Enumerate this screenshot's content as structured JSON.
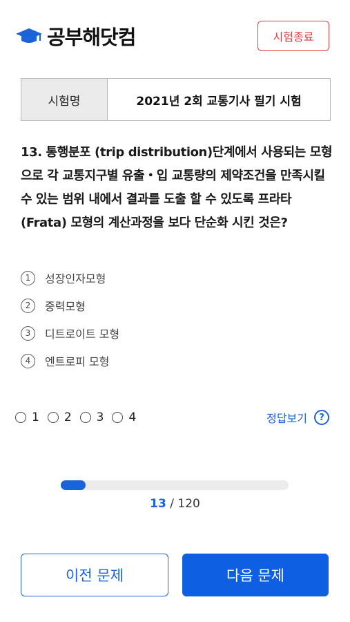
{
  "header": {
    "logo_text": "공부해닷컴",
    "end_button": "시험종료"
  },
  "exam": {
    "label": "시험명",
    "name": "2021년 2회 교통기사 필기 시험"
  },
  "question": {
    "text": "13. 통행분포 (trip distribution)단계에서 사용되는 모형으로 각 교통지구별 유출・입 교통량의 제약조건을 만족시킬 수 있는 범위 내에서 결과를 도출 할 수 있도록 프라타(Frata) 모형의 계산과정을 보다 단순화 시킨 것은?"
  },
  "options": [
    {
      "num": "1",
      "text": "성장인자모형"
    },
    {
      "num": "2",
      "text": "중력모형"
    },
    {
      "num": "3",
      "text": "디트로이트 모형"
    },
    {
      "num": "4",
      "text": "엔트로피 모형"
    }
  ],
  "answer_radios": [
    "1",
    "2",
    "3",
    "4"
  ],
  "show_answer": "정답보기",
  "help_icon_glyph": "?",
  "progress": {
    "current": "13",
    "separator": " / ",
    "total": "120",
    "fraction": 0.108
  },
  "nav": {
    "prev": "이전 문제",
    "next": "다음 문제"
  },
  "colors": {
    "accent": "#1a63d8",
    "danger": "#e0393e"
  }
}
